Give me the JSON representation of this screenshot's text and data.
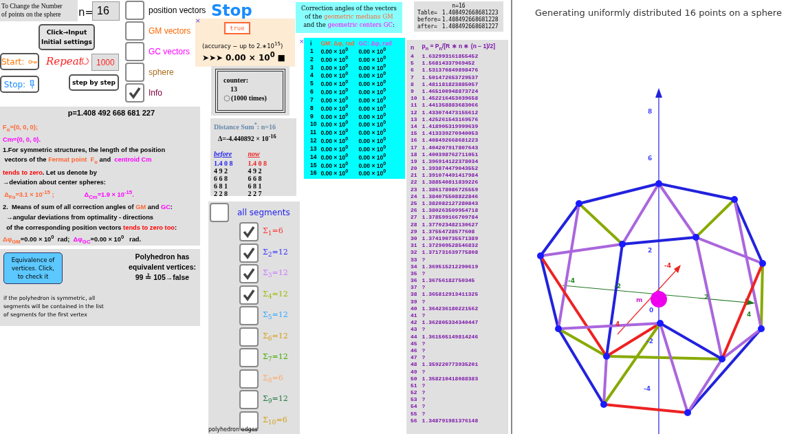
{
  "setup": {
    "prompt_lines": [
      "To Change the Number",
      "of points on the sphere"
    ],
    "n_label": "n=",
    "n_value": "16",
    "init_button": [
      "Click→Input",
      "Initial settings"
    ],
    "start_label": "Start:",
    "stop_label": "Stop:",
    "repeat_label": "Repeat",
    "repeat_value": "1000",
    "step_button": "step by step"
  },
  "toggles": [
    {
      "label": "position vectors",
      "color": "#000000",
      "checked": false
    },
    {
      "label": "GM vectors",
      "color": "#ff6600",
      "checked": false
    },
    {
      "label": "GC vectors",
      "color": "#ff00ff",
      "checked": false
    },
    {
      "label": "sphere",
      "color": "#a86c1a",
      "checked": false
    },
    {
      "label": "Info",
      "color": "#800040",
      "checked": true
    }
  ],
  "stop_title": "Stop",
  "accuracy": {
    "close": "×",
    "flag": "true",
    "note": "(accuracy − up to 2.∗10$^{15}$)",
    "result": "➤➤➤  **0.00 × 10$^{0}$** ■"
  },
  "counter": {
    "title": "counter:",
    "value": "13",
    "times": "(1000 times)"
  },
  "distance": {
    "title": "Distance Sum$^{*}$: **n=16**",
    "delta": "Δ=-4.440892 × 10$^{-16}$",
    "before_label": "before",
    "now_label": "now",
    "before": [
      "1.4 0 8",
      "4 9 2",
      "6 6 8",
      "6 8 1",
      "2 2 8"
    ],
    "now": [
      "1.4 0 8",
      "4 9 2",
      "6 6 8",
      "6 8 1",
      "2 2 7"
    ]
  },
  "info": {
    "p": "p=1.408 492 668 681 227",
    "lines": [
      [
        {
          "text": "F$_{o}$=(0, 0, 0);",
          "kind": "gm"
        }
      ],
      [
        {
          "text": "Cm=(0, 0, 0).",
          "kind": "gc"
        }
      ],
      [
        {
          "text": "1.For symmetric structures, the length of the position",
          "kind": "text"
        }
      ],
      [
        {
          "text": " vectors of the ",
          "kind": "text"
        },
        {
          "text": "Fermat point  F$_{o}$",
          "kind": "gm"
        },
        {
          "text": " and  ",
          "kind": "text"
        },
        {
          "text": "centroid Cm",
          "kind": "gc"
        }
      ],
      [
        {
          "text": "tends to zero",
          "kind": "emphasis"
        },
        {
          "text": ". Let us denote by",
          "kind": "text"
        }
      ],
      [
        {
          "text": "→deviation about center spheres:",
          "kind": "text"
        }
      ],
      [
        {
          "text": " Δ$_{Fo}$=3.1 × 10$^{-15}$ ;                 ",
          "kind": "gm"
        },
        {
          "text": "Δ$_{Cm}$=1.9 × 10$^{-15}$.",
          "kind": "gc"
        }
      ],
      [
        {
          "text": "2.  Means of sum of all correction angles of ",
          "kind": "text"
        },
        {
          "text": "GM",
          "kind": "gm"
        },
        {
          "text": " and ",
          "kind": "text"
        },
        {
          "text": "GC",
          "kind": "gc"
        },
        {
          "text": ":",
          "kind": "text"
        }
      ],
      [
        {
          "text": "  →angular deviations from optimality - directions",
          "kind": "text"
        }
      ],
      [
        {
          "text": "  of the corresponding position vectors ",
          "kind": "text"
        },
        {
          "text": "tends to zero too",
          "kind": "emphasis"
        },
        {
          "text": ":",
          "kind": "text"
        }
      ],
      [
        {
          "text": "Δφ$_{GM}$",
          "kind": "gm"
        },
        {
          "text": "=0.00 × 10$^{0}$  rad;  ",
          "kind": "text"
        },
        {
          "text": "Δφ$_{GC}$",
          "kind": "gc"
        },
        {
          "text": "=0.00 × 10$^{0}$   rad.",
          "kind": "text"
        }
      ]
    ]
  },
  "equivalence": {
    "button": [
      "Equivalence of",
      "vertices. Click,",
      "to check it"
    ],
    "result_lines": [
      "Polyhedron has",
      "equivalent vertices:",
      "99 ≟ 105→false"
    ],
    "note": "if the polyhedron is symmetric, all segments will be contained in the list of segments for the first vertex"
  },
  "corrections": {
    "title": [
      "Correction angles of the vectors"
    ],
    "title_line2": [
      {
        "text": "of the  ",
        "kind": "text"
      },
      {
        "text": "geometric medians GM",
        "kind": "gm"
      }
    ],
    "title_line3": [
      {
        "text": "and the ",
        "kind": "text"
      },
      {
        "text": "geometric centers  GC",
        "kind": "gc"
      },
      {
        "text": ":",
        "kind": "text"
      }
    ],
    "close": "×",
    "columns": [
      "i",
      "GM: Δφ, rad",
      "GC: Δφ, rad"
    ],
    "rows": [
      [
        "1",
        "0.00 × 10$^{0}$",
        "0.00 × 10$^{0}$"
      ],
      [
        "2",
        "0.00 × 10$^{0}$",
        "0.00 × 10$^{0}$"
      ],
      [
        "3",
        "0.00 × 10$^{0}$",
        "0.00 × 10$^{0}$"
      ],
      [
        "4",
        "0.00 × 10$^{0}$",
        "0.00 × 10$^{0}$"
      ],
      [
        "5",
        "0.00 × 10$^{0}$",
        "0.00 × 10$^{0}$"
      ],
      [
        "6",
        "0.00 × 10$^{0}$",
        "0.00 × 10$^{0}$"
      ],
      [
        "7",
        "0.00 × 10$^{0}$",
        "0.00 × 10$^{0}$"
      ],
      [
        "8",
        "0.00 × 10$^{0}$",
        "0.00 × 10$^{0}$"
      ],
      [
        "9",
        "0.00 × 10$^{0}$",
        "0.00 × 10$^{0}$"
      ],
      [
        "10",
        "0.00 × 10$^{0}$",
        "0.00 × 10$^{0}$"
      ],
      [
        "11",
        "0.00 × 10$^{0}$",
        "0.00 × 10$^{0}$"
      ],
      [
        "12",
        "0.00 × 10$^{0}$",
        "0.00 × 10$^{0}$"
      ],
      [
        "13",
        "0.00 × 10$^{0}$",
        "0.00 × 10$^{0}$"
      ],
      [
        "14",
        "0.00 × 10$^{0}$",
        "0.00 × 10$^{0}$"
      ],
      [
        "15",
        "0.00 × 10$^{0}$",
        "0.00 × 10$^{0}$"
      ],
      [
        "16",
        "0.00 × 10$^{0}$",
        "0.00 × 10$^{0}$"
      ]
    ]
  },
  "summary": {
    "title": "n=16",
    "rows": [
      [
        "Table=",
        "1.408492668681223"
      ],
      [
        "before=",
        "1.408492668681228"
      ],
      [
        "after=",
        "1.408492668681227"
      ]
    ]
  },
  "p_table": {
    "columns": [
      "n",
      "p$_{n}$ = P$_{n}$/[R ∗ n ∗ (n − 1)/2]"
    ],
    "rows": [
      [
        "4",
        "1.632993161855452"
      ],
      [
        "5",
        "1.56814337969452"
      ],
      [
        "6",
        "1.531370849898476"
      ],
      [
        "7",
        "1.501472653729537"
      ],
      [
        "8",
        "1.481181823885057"
      ],
      [
        "9",
        "1.465100948873724"
      ],
      [
        "10",
        "1.452216453039658"
      ],
      [
        "11",
        "1.441358883683066"
      ],
      [
        "12",
        "1.433074473155612"
      ],
      [
        "13",
        "1.425261543169576"
      ],
      [
        "14",
        "1.418905319999639"
      ],
      [
        "15",
        "1.413339270940053"
      ],
      [
        "16",
        "1.408492668681223"
      ],
      [
        "17",
        "1.404207917807643"
      ],
      [
        "18",
        "1.400398762711051"
      ],
      [
        "19",
        "1.396914122378034"
      ],
      [
        "20",
        "1.393874479043552"
      ],
      [
        "21",
        "1.391074491417984"
      ],
      [
        "22",
        "1.388540811839226"
      ],
      [
        "23",
        "1.386178086725559"
      ],
      [
        "24",
        "1.384075508822846"
      ],
      [
        "25",
        "1.382082127280843"
      ],
      [
        "26",
        "1.380263509954718"
      ],
      [
        "27",
        "1.378599166709784"
      ],
      [
        "28",
        "1.377023482130627"
      ],
      [
        "29",
        "1.37554728577608"
      ],
      [
        "30",
        "1.374190735571389"
      ],
      [
        "31",
        "1.372909528546832"
      ],
      [
        "32",
        "1.371731639775808"
      ],
      [
        "33",
        "?"
      ],
      [
        "34",
        "1.369515212290619"
      ],
      [
        "35",
        "?"
      ],
      [
        "36",
        "1.36756182750345"
      ],
      [
        "37",
        "?"
      ],
      [
        "38",
        "1.365812913411325"
      ],
      [
        "39",
        "?"
      ],
      [
        "40",
        "1.364236180221562"
      ],
      [
        "41",
        "?"
      ],
      [
        "42",
        "1.362805334340447"
      ],
      [
        "43",
        "?"
      ],
      [
        "44",
        "1.361505149814246"
      ],
      [
        "45",
        "?"
      ],
      [
        "46",
        "?"
      ],
      [
        "47",
        "?"
      ],
      [
        "48",
        "1.359220773935201"
      ],
      [
        "49",
        "?"
      ],
      [
        "50",
        "1.358210418088383"
      ],
      [
        "51",
        "?"
      ],
      [
        "52",
        "?"
      ],
      [
        "53",
        "?"
      ],
      [
        "54",
        "?"
      ],
      [
        "55",
        "?"
      ],
      [
        "56",
        "1.348791981376148"
      ]
    ]
  },
  "segments": {
    "all": {
      "label": "all segments",
      "checked": false
    },
    "items": [
      {
        "label": "Σ$_{1}$=6",
        "color": "#ff3333",
        "checked": true
      },
      {
        "label": "Σ$_{2}$=12",
        "color": "#3333ff",
        "checked": true
      },
      {
        "label": "Σ$_{3}$=12",
        "color": "#cc77ff",
        "checked": true
      },
      {
        "label": "Σ$_{4}$=12",
        "color": "#99bb00",
        "checked": true
      },
      {
        "label": "Σ$_{5}$=12",
        "color": "#33aaff",
        "checked": false
      },
      {
        "label": "Σ$_{6}$=12",
        "color": "#d4a017",
        "checked": false
      },
      {
        "label": "Σ$_{7}$=12",
        "color": "#44aa00",
        "checked": false
      },
      {
        "label": "Σ$_{8}$=6",
        "color": "#ffaa66",
        "checked": false
      },
      {
        "label": "Σ$_{9}$=12",
        "color": "#227744",
        "checked": false
      },
      {
        "label": "Σ$_{10}$=6",
        "color": "#d4a017",
        "checked": false
      }
    ],
    "footer": "polyhedron edges"
  },
  "graphics": {
    "title": "Generating uniformly distributed  16 points on a sphere",
    "axis_labels": [
      "8",
      "6",
      "2",
      "-4",
      "-2",
      "2",
      "4",
      "-4",
      "0",
      "-2",
      "-4",
      "4"
    ],
    "center_label": "m"
  }
}
